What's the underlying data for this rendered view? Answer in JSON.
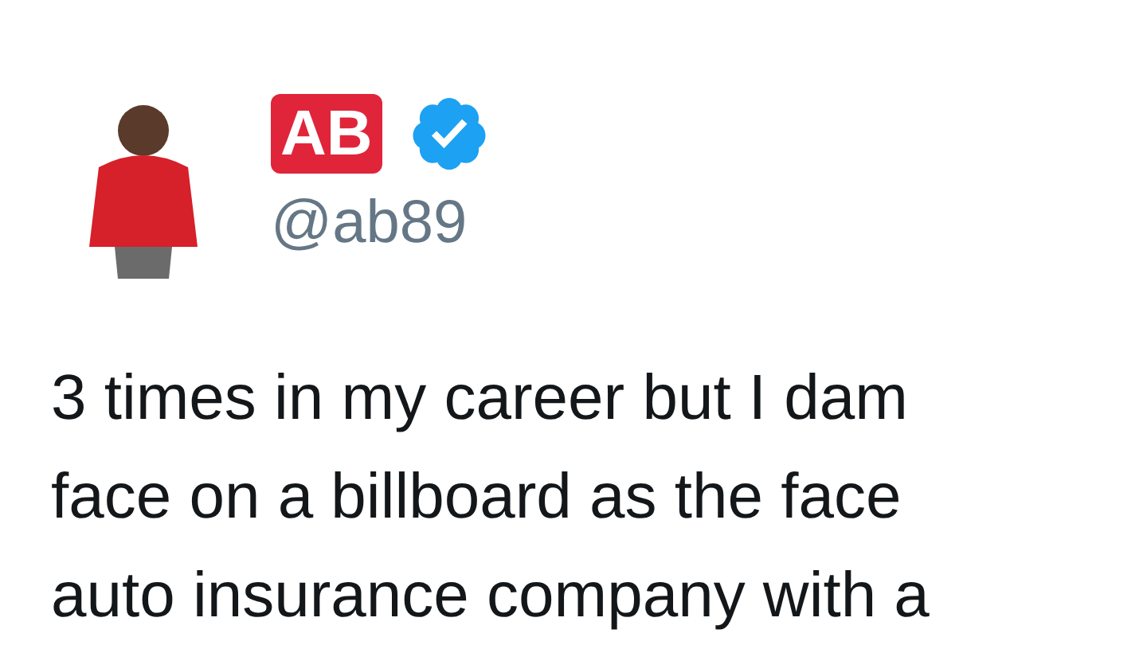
{
  "tweet": {
    "display_name": "AB",
    "verified": true,
    "handle": "@ab89",
    "lines": [
      "3 times in my career but I dam",
      "face on a billboard as the face",
      "auto insurance company with a"
    ]
  }
}
